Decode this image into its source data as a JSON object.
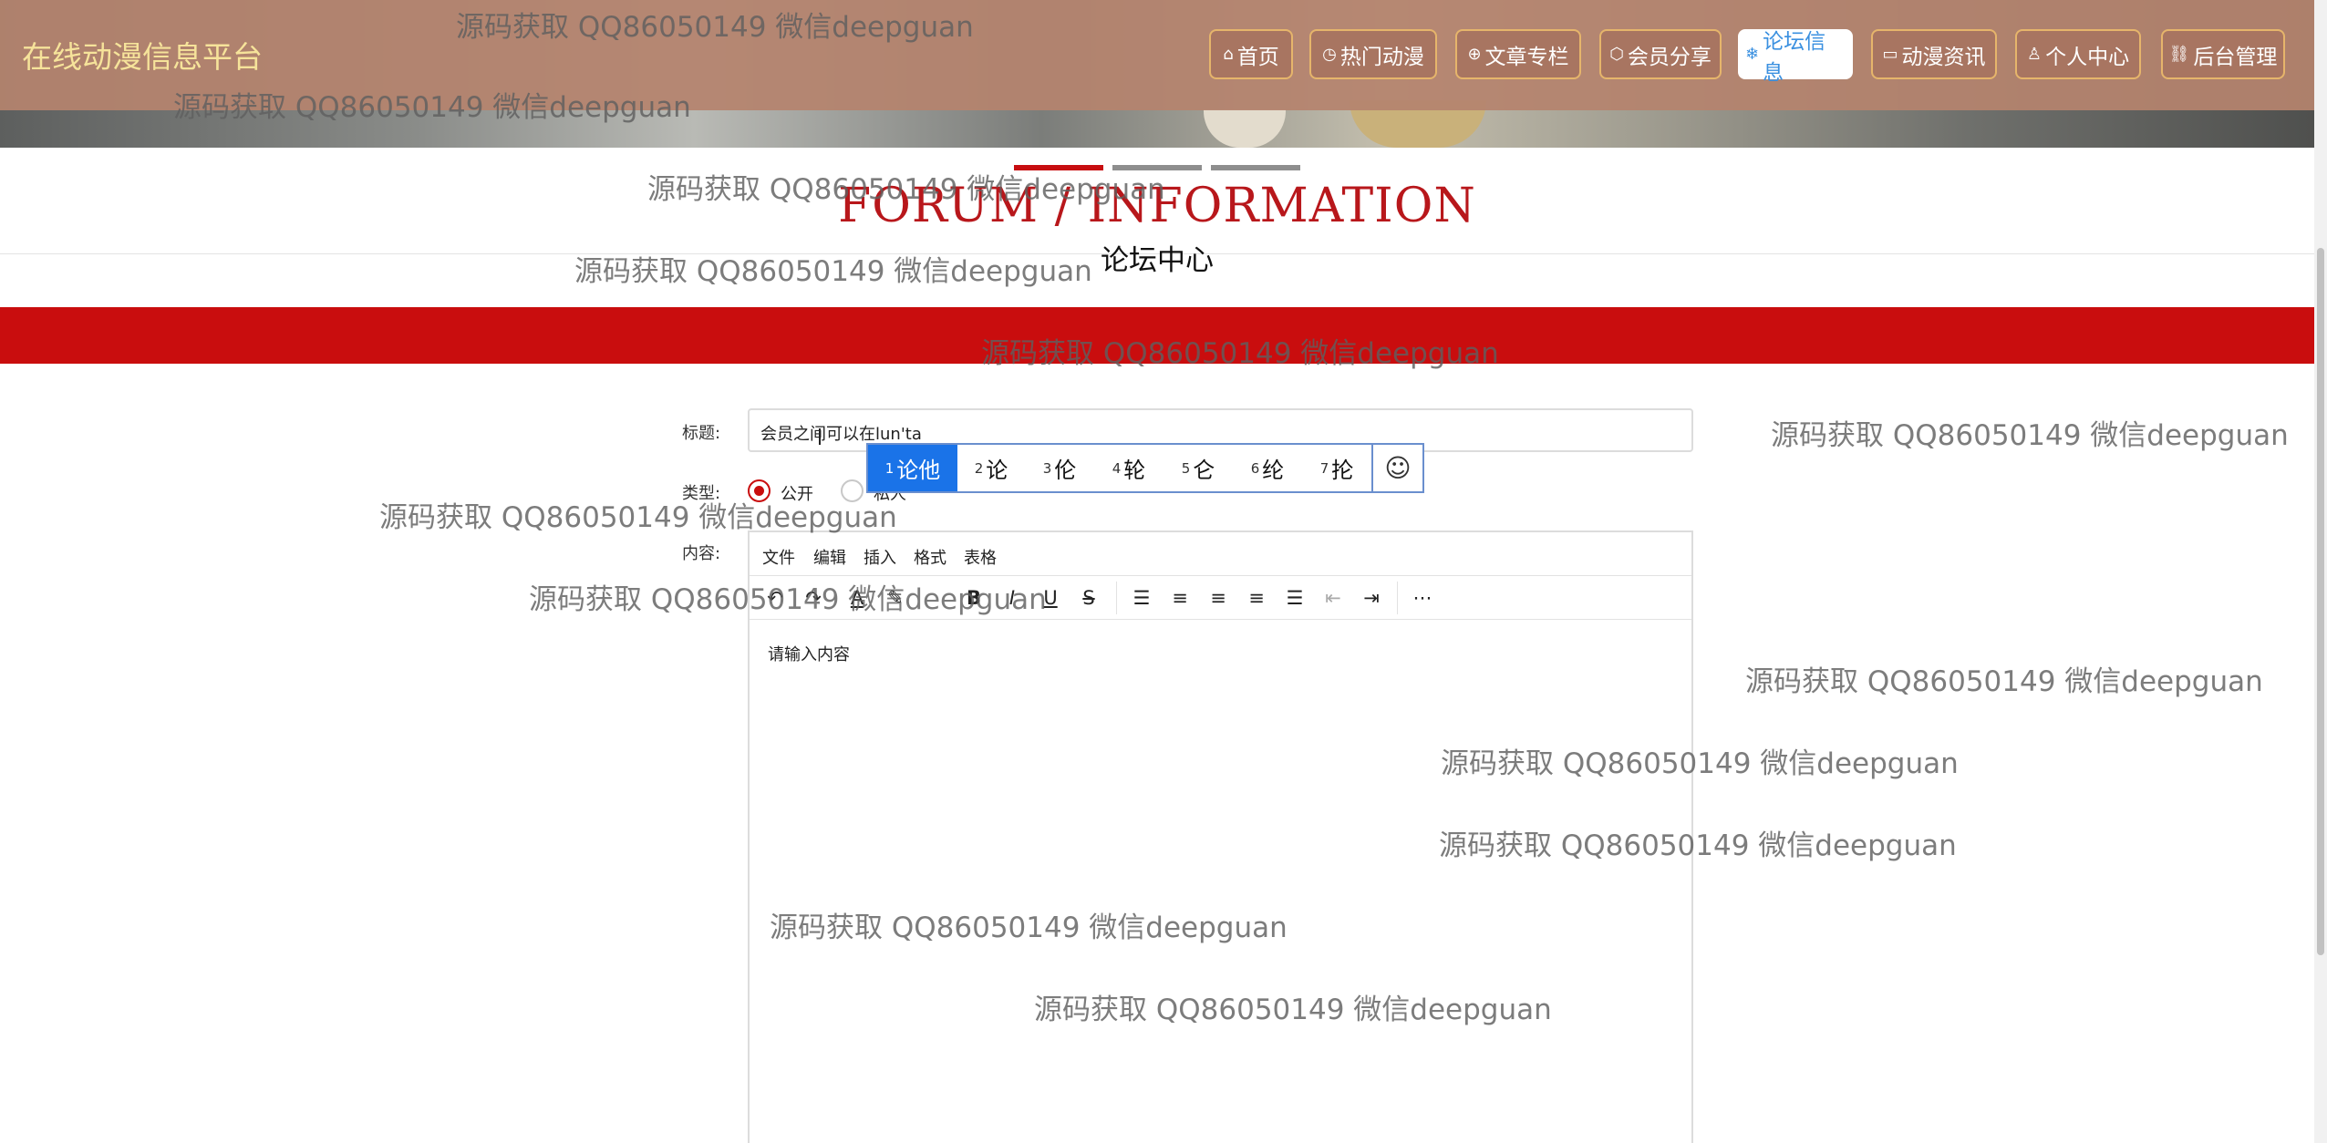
{
  "header": {
    "site_title": "在线动漫信息平台",
    "nav": [
      {
        "label": "首页",
        "icon": "home-icon"
      },
      {
        "label": "热门动漫",
        "icon": "clock-icon"
      },
      {
        "label": "文章专栏",
        "icon": "globe-icon"
      },
      {
        "label": "会员分享",
        "icon": "cube-icon"
      },
      {
        "label": "论坛信息",
        "icon": "snowflake-icon",
        "active": true
      },
      {
        "label": "动漫资讯",
        "icon": "book-icon"
      },
      {
        "label": "个人中心",
        "icon": "user-icon"
      },
      {
        "label": "后台管理",
        "icon": "link-icon"
      }
    ]
  },
  "section": {
    "title_en": "FORUM / INFORMATION",
    "title_cn": "论坛中心"
  },
  "form": {
    "title_label": "标题:",
    "title_value": "会员之间可以在lun'ta",
    "type_label": "类型:",
    "type_options": [
      "公开",
      "私人"
    ],
    "type_selected": "公开",
    "content_label": "内容:",
    "editor_menu": [
      "文件",
      "编辑",
      "插入",
      "格式",
      "表格"
    ],
    "editor_placeholder": "请输入内容",
    "toolbar_icons": [
      "undo-icon",
      "redo-icon",
      "font-color-icon",
      "highlight-icon",
      "bold-icon",
      "italic-icon",
      "underline-icon",
      "strikethrough-icon",
      "line-height-icon",
      "align-left-icon",
      "align-center-icon",
      "align-right-icon",
      "align-justify-icon",
      "outdent-icon",
      "indent-icon",
      "more-icon"
    ]
  },
  "ime": {
    "candidates": [
      {
        "num": "1",
        "text": "论他"
      },
      {
        "num": "2",
        "text": "论"
      },
      {
        "num": "3",
        "text": "伦"
      },
      {
        "num": "4",
        "text": "轮"
      },
      {
        "num": "5",
        "text": "仑"
      },
      {
        "num": "6",
        "text": "纶"
      },
      {
        "num": "7",
        "text": "抡"
      }
    ],
    "emoji_icon": "smiley-icon"
  },
  "watermark": "源码获取 QQ86050149 微信deepguan",
  "colors": {
    "header_bg": "#b5836e",
    "accent_red": "#c90d0e",
    "active_nav_text": "#3a90e0",
    "title_gold": "#f6e39a",
    "ime_selected": "#1a73e8"
  }
}
